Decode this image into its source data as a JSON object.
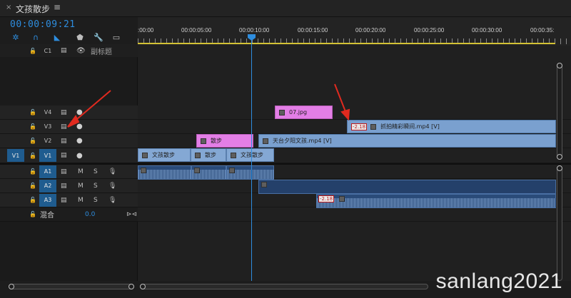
{
  "tab": {
    "close": "×",
    "title": "文孩散步",
    "menu": "≡"
  },
  "timecode": "00:00:09:21",
  "ruler": {
    "labels": [
      ":00:00",
      "00:00:05:00",
      "00:00:10:00",
      "00:00:15:00",
      "00:00:20:00",
      "00:00:25:00",
      "00:00:30:00",
      "00:00:35:"
    ]
  },
  "caption_track": {
    "lock": "🔓",
    "label": "C1",
    "eye": "👁",
    "name": "副标题"
  },
  "video_tracks": [
    {
      "id": "V4",
      "lock": "🔓"
    },
    {
      "id": "V3",
      "lock": "🔓"
    },
    {
      "id": "V2",
      "lock": "🔓"
    },
    {
      "id": "V1",
      "lock": "🔓",
      "source": "V1"
    }
  ],
  "audio_tracks": [
    {
      "id": "A1",
      "m": "M",
      "s": "S"
    },
    {
      "id": "A2",
      "m": "M",
      "s": "S"
    },
    {
      "id": "A3",
      "m": "M",
      "s": "S"
    }
  ],
  "mix": {
    "label": "混合",
    "value": "0.0"
  },
  "clips": {
    "v4_1": "07.jpg",
    "v3_1_speed": "-2.18",
    "v3_1": "抓拍精彩瞬间.mp4 [V]",
    "v2_1": "散步",
    "v2_2": "天台夕阳文孩.mp4 [V]",
    "v1_1": "文孩散步",
    "v1_2": "散步",
    "v1_3": "文孩散步",
    "a3_speed": "-2.18"
  },
  "watermark": "sanlang2021",
  "colors": {
    "accent": "#2e8dde",
    "workbar": "#d4c335",
    "arrow": "#e12a1f",
    "title_clip": "#e37ee6",
    "video_clip": "#7aa0cf",
    "audio_clip": "#2a4b79"
  },
  "icons": [
    "snap-icon",
    "link-icon",
    "marker-icon",
    "wrench-icon",
    "captions-icon",
    "lock-icon",
    "film-icon",
    "eye-icon",
    "mic-icon"
  ]
}
